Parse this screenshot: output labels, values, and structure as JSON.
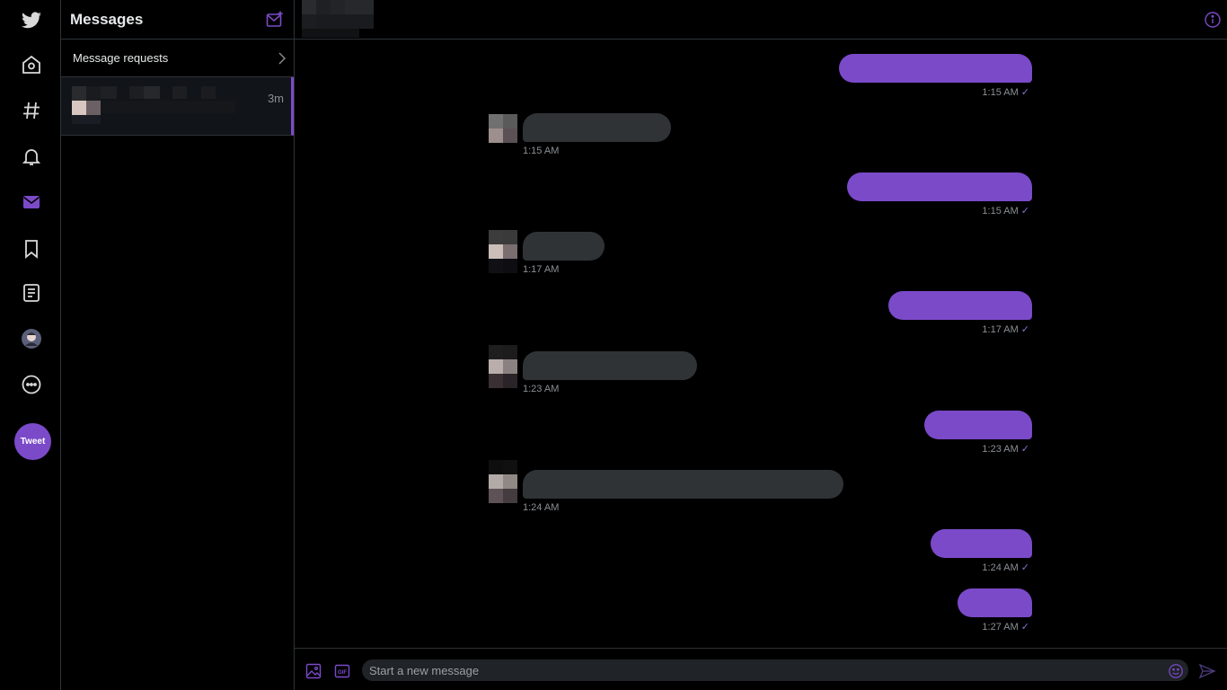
{
  "nav": {
    "items": [
      "twitter-logo",
      "home",
      "explore",
      "notifications",
      "messages",
      "bookmarks",
      "lists",
      "profile",
      "more"
    ],
    "tweet_label": "Tweet",
    "accent": "#7b4ac9"
  },
  "conversations": {
    "title": "Messages",
    "requests_label": "Message requests",
    "items": [
      {
        "time": "3m"
      }
    ]
  },
  "chat": {
    "messages": [
      {
        "dir": "out",
        "time": "1:15 AM",
        "read": true
      },
      {
        "dir": "in",
        "time": "1:15 AM"
      },
      {
        "dir": "out",
        "time": "1:15 AM",
        "read": true
      },
      {
        "dir": "in",
        "time": "1:17 AM"
      },
      {
        "dir": "out",
        "time": "1:17 AM",
        "read": true
      },
      {
        "dir": "in",
        "time": "1:23 AM"
      },
      {
        "dir": "out",
        "time": "1:23 AM",
        "read": true
      },
      {
        "dir": "in",
        "time": "1:24 AM"
      },
      {
        "dir": "out",
        "time": "1:24 AM",
        "read": true
      },
      {
        "dir": "out",
        "time": "1:27 AM",
        "read": true
      }
    ],
    "check_glyph": "✓"
  },
  "composer": {
    "placeholder": "Start a new message"
  }
}
